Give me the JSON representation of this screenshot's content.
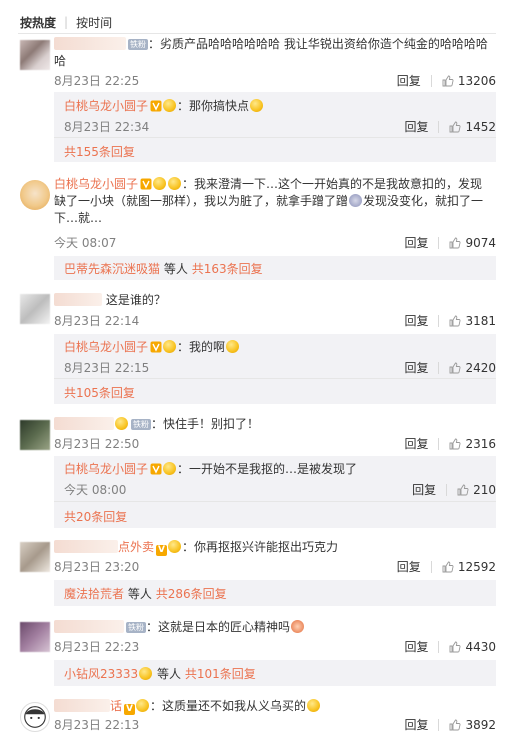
{
  "sort": {
    "hot": "按热度",
    "time": "按时间"
  },
  "labels": {
    "reply": "回复",
    "etc": "等人"
  },
  "comments": [
    {
      "user": "",
      "badge": "铁粉",
      "text": "：劣质产品哈哈哈哈哈哈  我让华锐出资给你造个纯金的哈哈哈哈哈",
      "time": "8月23日 22:25",
      "likes": "13206",
      "sub_user": "白桃乌龙小圆子",
      "sub_text": "：那你搞快点",
      "sub_time": "8月23日 22:34",
      "sub_likes": "1452",
      "more": "共155条回复"
    },
    {
      "user": "白桃乌龙小圆子",
      "text": "：我来澄清一下…这个一开始真的不是我故意扣的，发现缺了一小块（就图一那样），我以为脏了，就拿手蹭了蹭",
      "text2": "发现没变化，就扣了一下…就…",
      "time": "今天 08:07",
      "likes": "9074",
      "more_who": "巴蒂先森沉迷吸猫",
      "more": "共163条回复"
    },
    {
      "user": "",
      "text": "这是谁的？",
      "time": "8月23日 22:14",
      "likes": "3181",
      "sub_user": "白桃乌龙小圆子",
      "sub_text": "：我的啊",
      "sub_time": "8月23日 22:15",
      "sub_likes": "2420",
      "more": "共105条回复"
    },
    {
      "user": "",
      "badge": "铁粉",
      "text": "：快住手！别扣了！",
      "time": "8月23日 22:50",
      "likes": "2316",
      "sub_user": "白桃乌龙小圆子",
      "sub_text": "：一开始不是我抠的…是被发现了",
      "sub_time": "今天 08:00",
      "sub_likes": "210",
      "more": "共20条回复"
    },
    {
      "user": "点外卖",
      "text": "：你再抠抠兴许能抠出巧克力",
      "time": "8月23日 23:20",
      "likes": "12592",
      "more_who": "魔法拾荒者",
      "more": "共286条回复"
    },
    {
      "user": "",
      "badge": "铁粉",
      "text": "：这就是日本的匠心精神吗",
      "time": "8月23日 22:23",
      "likes": "4430",
      "more_who": "小钻风23333",
      "more": "共101条回复"
    },
    {
      "user": "话",
      "text": "：这质量还不如我从义乌买的",
      "time": "8月23日 22:13",
      "likes": "3892"
    }
  ]
}
